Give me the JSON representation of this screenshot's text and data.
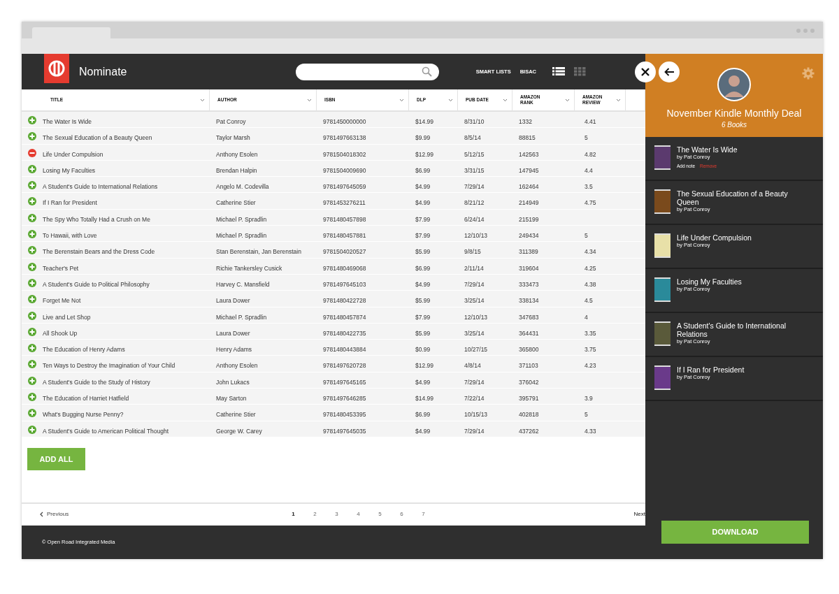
{
  "app": {
    "title": "Nominate",
    "nav": [
      "SMART LISTS",
      "BISAC"
    ],
    "view_modes": [
      {
        "kind": "list",
        "selected": true
      },
      {
        "kind": "grid",
        "selected": false
      }
    ]
  },
  "table": {
    "columns": [
      "TITLE",
      "AUTHOR",
      "ISBN",
      "DLP",
      "PUB DATE",
      "AMAZON RANK",
      "AMAZON REVIEW"
    ],
    "rows": [
      {
        "added": false,
        "cells": [
          "The Water Is Wide",
          "Pat Conroy",
          "9781450000000",
          "$14.99",
          "8/31/10",
          "1332",
          "4.41"
        ]
      },
      {
        "added": false,
        "cells": [
          "The Sexual Education of a Beauty Queen",
          "Taylor Marsh",
          "9781497663138",
          "$9.99",
          "8/5/14",
          "88815",
          "5"
        ]
      },
      {
        "added": true,
        "cells": [
          "Life Under Compulsion",
          "Anthony Esolen",
          "9781504018302",
          "$12.99",
          "5/12/15",
          "142563",
          "4.82"
        ]
      },
      {
        "added": false,
        "cells": [
          "Losing My Faculties",
          "Brendan Halpin",
          "9781504009690",
          "$6.99",
          "3/31/15",
          "147945",
          "4.4"
        ]
      },
      {
        "added": false,
        "cells": [
          "A Student's Guide to International Relations",
          "Angelo M. Codevilla",
          "9781497645059",
          "$4.99",
          "7/29/14",
          "162464",
          "3.5"
        ]
      },
      {
        "added": false,
        "cells": [
          "If I Ran for President",
          "Catherine Stier",
          "9781453276211",
          "$4.99",
          "8/21/12",
          "214949",
          "4.75"
        ]
      },
      {
        "added": false,
        "cells": [
          "The Spy Who Totally Had a Crush on Me",
          "Michael P. Spradlin",
          "9781480457898",
          "$7.99",
          "6/24/14",
          "215199",
          ""
        ]
      },
      {
        "added": false,
        "cells": [
          "To Hawaii, with Love",
          "Michael P. Spradlin",
          "9781480457881",
          "$7.99",
          "12/10/13",
          "249434",
          "5"
        ]
      },
      {
        "added": false,
        "cells": [
          "The Berenstain Bears and the Dress Code",
          "Stan Berenstain, Jan Berenstain",
          "9781504020527",
          "$5.99",
          "9/8/15",
          "311389",
          "4.34"
        ]
      },
      {
        "added": false,
        "cells": [
          "Teacher's Pet",
          "Richie Tankersley Cusick",
          "9781480469068",
          "$6.99",
          "2/11/14",
          "319604",
          "4.25"
        ]
      },
      {
        "added": false,
        "cells": [
          "A Student's Guide to Political Philosophy",
          "Harvey C. Mansfield",
          "9781497645103",
          "$4.99",
          "7/29/14",
          "333473",
          "4.38"
        ]
      },
      {
        "added": false,
        "cells": [
          "Forget Me Not",
          "Laura Dower",
          "9781480422728",
          "$5.99",
          "3/25/14",
          "338134",
          "4.5"
        ]
      },
      {
        "added": false,
        "cells": [
          "Live and Let Shop",
          "Michael P. Spradlin",
          "9781480457874",
          "$7.99",
          "12/10/13",
          "347683",
          "4"
        ]
      },
      {
        "added": false,
        "cells": [
          "All Shook Up",
          "Laura Dower",
          "9781480422735",
          "$5.99",
          "3/25/14",
          "364431",
          "3.35"
        ]
      },
      {
        "added": false,
        "cells": [
          "The Education of Henry Adams",
          "Henry Adams",
          "9781480443884",
          "$0.99",
          "10/27/15",
          "365800",
          "3.75"
        ]
      },
      {
        "added": false,
        "cells": [
          "Ten Ways to Destroy the Imagination of Your Child",
          "Anthony Esolen",
          "9781497620728",
          "$12.99",
          "4/8/14",
          "371103",
          "4.23"
        ]
      },
      {
        "added": false,
        "cells": [
          "A Student's Guide to the Study of History",
          "John Lukacs",
          "9781497645165",
          "$4.99",
          "7/29/14",
          "376042",
          ""
        ]
      },
      {
        "added": false,
        "cells": [
          "The Education of Harriet Hatfield",
          "May Sarton",
          "9781497646285",
          "$14.99",
          "7/22/14",
          "395791",
          "3.9"
        ]
      },
      {
        "added": false,
        "cells": [
          "What's Bugging Nurse Penny?",
          "Catherine Stier",
          "9781480453395",
          "$6.99",
          "10/15/13",
          "402818",
          "5"
        ]
      },
      {
        "added": false,
        "cells": [
          "A Student's Guide to American Political Thought",
          "George W. Carey",
          "9781497645035",
          "$4.99",
          "7/29/14",
          "437262",
          "4.33"
        ]
      }
    ]
  },
  "add_all_button": "ADD ALL",
  "pagination": {
    "previous": "Previous",
    "pages": [
      {
        "label": "1",
        "selected": true
      },
      {
        "label": "2",
        "selected": false
      },
      {
        "label": "3",
        "selected": false
      },
      {
        "label": "4",
        "selected": false
      },
      {
        "label": "5",
        "selected": false
      },
      {
        "label": "6",
        "selected": false
      },
      {
        "label": "7",
        "selected": false
      }
    ],
    "next": "Next"
  },
  "footer": "© Open Road Integrated Media",
  "panel": {
    "title": "November Kindle Monthly Deal",
    "subtitle": "6 Books",
    "books": [
      {
        "title": "The Water Is Wide",
        "byline": "by Pat Conroy",
        "actions": [
          "Add note",
          "Remove"
        ]
      },
      {
        "title": "The Sexual Education of a Beauty Queen",
        "byline": "by Pat Conroy"
      },
      {
        "title": "Life Under Compulsion",
        "byline": "by Pat Conroy"
      },
      {
        "title": "Losing My Faculties",
        "byline": "by Pat Conroy"
      },
      {
        "title": "A Student's Guide to International Relations",
        "byline": "by Pat Conroy"
      },
      {
        "title": "If I Ran for President",
        "byline": "by Pat Conroy"
      }
    ],
    "download_button": "DOWNLOAD"
  }
}
